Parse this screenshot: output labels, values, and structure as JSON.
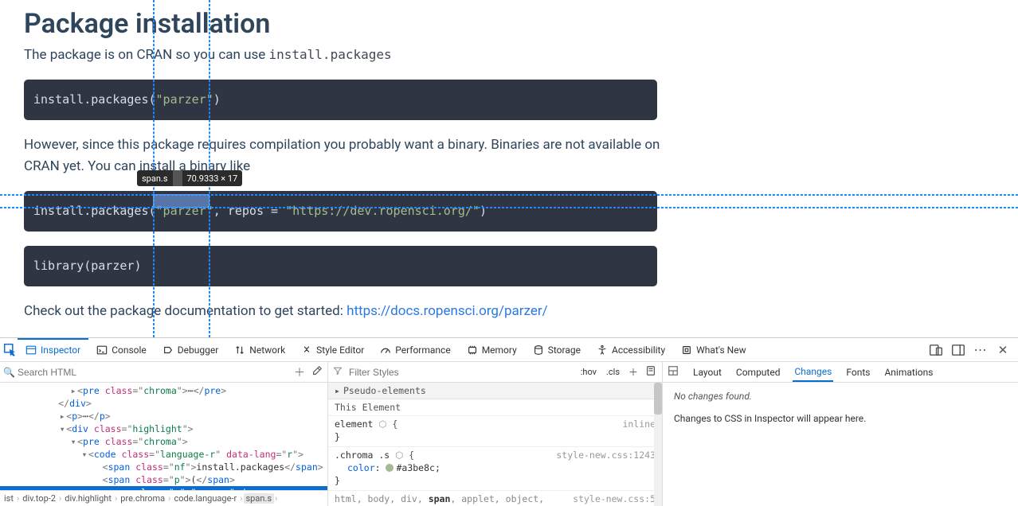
{
  "page": {
    "title": "Package installation",
    "intro_before_code": "The package is on CRAN so you can use ",
    "intro_code": "install.packages",
    "code1": {
      "fn": "install.packages",
      "open": "(",
      "str": "\"parzer\"",
      "close": ")"
    },
    "para2": "However, since this package requires compilation you probably want a binary. Binaries are not available on CRAN yet. You can install a binary like",
    "code2": {
      "fn": "install.packages",
      "open": "(",
      "str": "\"parzer\"",
      "comma": ", ",
      "kw": "repos",
      "eq": " = ",
      "url": "\"https://dev.ropensci.org/\"",
      "close": ")"
    },
    "code3": {
      "fn": "library",
      "open": "(",
      "arg": "parzer",
      "close": ")"
    },
    "para3_text": "Check out the package documentation to get started: ",
    "para3_link": "https://docs.ropensci.org/parzer/",
    "tooltip_selector": "span.s",
    "tooltip_dims": "70.9333 × 17"
  },
  "devtools": {
    "tabs": [
      "Inspector",
      "Console",
      "Debugger",
      "Network",
      "Style Editor",
      "Performance",
      "Memory",
      "Storage",
      "Accessibility",
      "What's New"
    ],
    "active_tab": "Inspector",
    "search_placeholder": "Search HTML",
    "tree": {
      "l0_pre": "<pre class=\"chroma\">…</pre>",
      "l1_div": "</div>",
      "l2_p": "<p>…</p>",
      "l3_div": "<div class=\"highlight\">",
      "l4_pre": "<pre class=\"chroma\">",
      "l5_code": "<code class=\"language-r\" data-lang=\"r\">",
      "l6_span_nf": "<span class=\"nf\">install.packages</span>",
      "l7_span_p": "<span class=\"p\">(</span>",
      "l8_span_s": "<span class=\"s\">\"parzer\"</span>"
    },
    "crumbs": [
      "ist",
      "div.top-2",
      "div.highlight",
      "pre.chroma",
      "code.language-r",
      "span.s"
    ],
    "filter_placeholder": "Filter Styles",
    "filter_opts": [
      ":hov",
      ".cls"
    ],
    "rules": {
      "pseudo": "Pseudo-elements",
      "this": "This Element",
      "r1_sel": "element",
      "r1_src": "inline",
      "r2_sel": ".chroma .s",
      "r2_src": "style-new.css:1243",
      "r2_prop": "color",
      "r2_val": "#a3be8c",
      "r3_sel": "html, body, div, span, applet, object,",
      "r3_src": "style-new.css:5"
    },
    "subtabs": [
      "Layout",
      "Computed",
      "Changes",
      "Fonts",
      "Animations"
    ],
    "active_subtab": "Changes",
    "changes_none": "No changes found.",
    "changes_hint": "Changes to CSS in Inspector will appear here."
  }
}
